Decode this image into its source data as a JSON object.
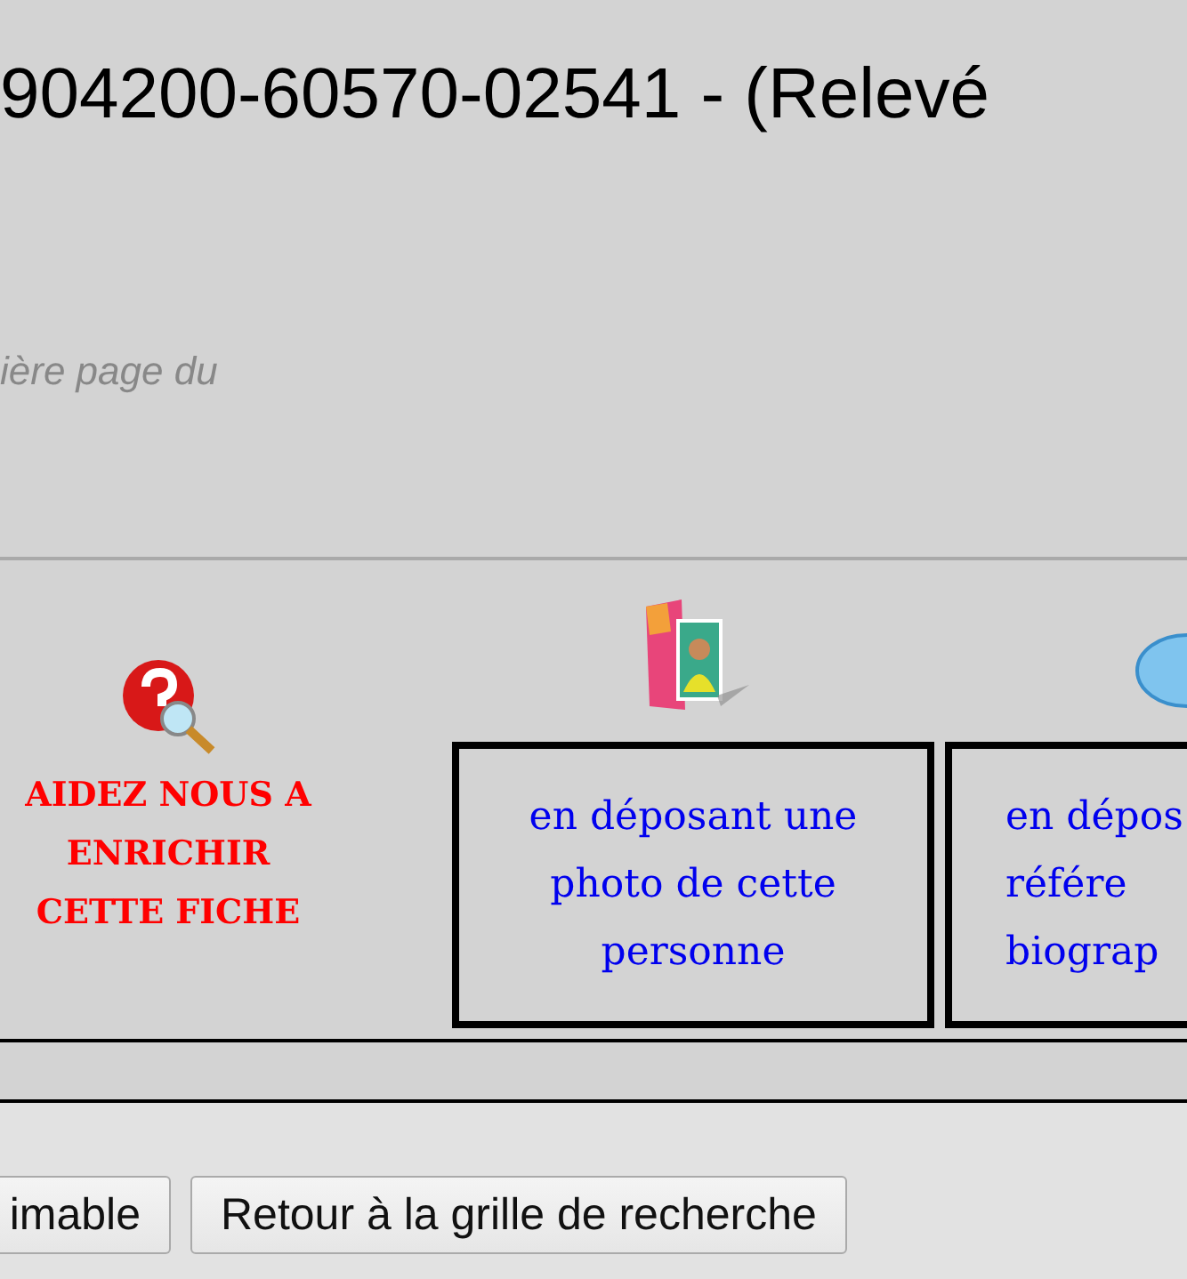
{
  "header": {
    "title": "904200-60570-02541 - (Relevé",
    "subtitle": "ière page du"
  },
  "help": {
    "label": "AIDEZ NOUS A ENRICHIR CETTE FICHE"
  },
  "cards": [
    {
      "kind": "photo",
      "lines": [
        "en déposant une",
        "photo de cette",
        "personne"
      ]
    },
    {
      "kind": "bio",
      "lines": [
        "en dépos",
        "référe",
        "biograp"
      ]
    }
  ],
  "buttons": [
    {
      "label": "imable"
    },
    {
      "label": "Retour à la grille de recherche"
    }
  ]
}
